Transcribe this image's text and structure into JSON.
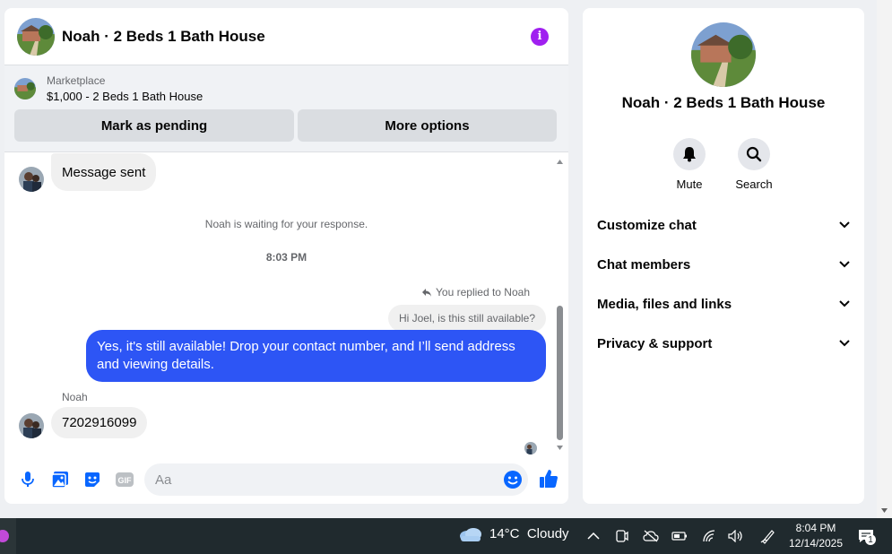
{
  "chat": {
    "title": "Noah · 2 Beds 1 Bath House",
    "info_icon": "info-icon"
  },
  "marketplace": {
    "label": "Marketplace",
    "item": "$1,000 - 2 Beds 1 Bath House",
    "mark_pending": "Mark as pending",
    "more_options": "More options"
  },
  "messages": {
    "first_bubble": "Message sent",
    "waiting": "Noah is waiting for your response.",
    "time": "8:03 PM",
    "reply_note": "You replied to Noah",
    "quoted": "Hi Joel, is this still available?",
    "reply": "Yes, it's still available! Drop your contact number, and I’ll send address and viewing details.",
    "sender": "Noah",
    "phone": "7202916099"
  },
  "composer": {
    "placeholder": "Aa",
    "icons": [
      "microphone-icon",
      "photo-icon",
      "sticker-icon",
      "gif-icon",
      "emoji-icon",
      "like-icon"
    ]
  },
  "info": {
    "title": "Noah · 2 Beds 1 Bath House",
    "mute": "Mute",
    "search": "Search",
    "sections": [
      "Customize chat",
      "Chat members",
      "Media, files and links",
      "Privacy & support"
    ]
  },
  "taskbar": {
    "weather": "14°C  Cloudy",
    "time": "8:04 PM",
    "date": "12/14/2025",
    "notifications": "1"
  },
  "colors": {
    "accent_blue": "#2d55f5",
    "info_purple": "#a020f0",
    "like_blue": "#0866ff"
  }
}
